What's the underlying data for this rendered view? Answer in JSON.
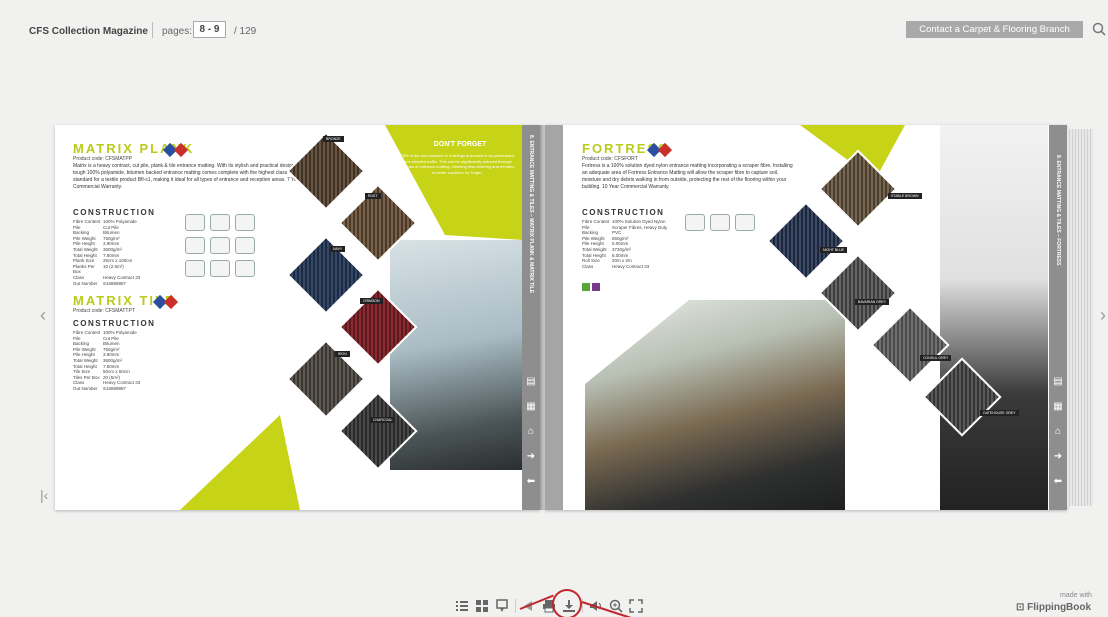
{
  "header": {
    "title": "CFS Collection Magazine",
    "pages_label": "pages:",
    "pages_value": "8 - 9",
    "pages_total": "/ 129",
    "contact_label": "Contact a Carpet & Flooring Branch"
  },
  "left_page": {
    "product1_title": "MATRIX PLANK",
    "product1_code": "Product code: CFSMATPP",
    "product1_desc": "Matrix is a heavy contract, cut pile, plank & tile entrance matting. With its stylish and practical design this tough 100% polyamide, bitumen backed entrance matting comes complete with the highest class of fire standard for a textile product Bfl-s1, making it ideal for all types of entrance and reception areas. 7 Year Commercial Warranty.",
    "construction_label": "CONSTRUCTION",
    "product1_specs": [
      [
        "Fibre Content",
        "100% Polyamide"
      ],
      [
        "Pile",
        "Cut Pile"
      ],
      [
        "Backing",
        "Bitumen"
      ],
      [
        "Pile Weight",
        "750g/m²"
      ],
      [
        "Pile Height",
        "3.90mm"
      ],
      [
        "Total Weight",
        "3600g/m²"
      ],
      [
        "Total Height",
        "7.60mm"
      ],
      [
        "Plank Size",
        "25cm x 100cm"
      ],
      [
        "Planks Per Box",
        "10 (2.5m²)"
      ],
      [
        "Class",
        "Heavy Contract 33"
      ],
      [
        "Gut Number",
        "S16889887"
      ]
    ],
    "product2_title": "MATRIX TILE",
    "product2_code": "Product code: CFSMATTPT",
    "product2_specs": [
      [
        "Fibre Content",
        "100% Polyamide"
      ],
      [
        "Pile",
        "Cut Pile"
      ],
      [
        "Backing",
        "Bitumen"
      ],
      [
        "Pile Weight",
        "750g/m²"
      ],
      [
        "Pile Height",
        "3.90mm"
      ],
      [
        "Total Weight",
        "3600g/m²"
      ],
      [
        "Total Height",
        "7.60mm"
      ],
      [
        "Tile Size",
        "50cm x 50cm"
      ],
      [
        "Tiles Per Box",
        "20 (5m²)"
      ],
      [
        "Class",
        "Heavy Contract 33"
      ],
      [
        "Gut Number",
        "S16889887"
      ]
    ],
    "dont_forget_title": "DON'T FORGET",
    "dont_forget_text": "75% of dirt and moisture in buildings is tracked in by pedestrians and wheeled traffic. This can be significantly reduced through the use of entrance matting, meaning less cleaning and remains is better condition for longer.",
    "strip_text": "8. ENTRANCE MATTING & TILES – MATRIX PLANK & MATRIX TILE",
    "swatch_labels": [
      "BRONZE",
      "RUST",
      "NAVY",
      "CRIMSON",
      "IRON",
      "CHARCOAL"
    ],
    "swatch_colors": [
      "#3d3226",
      "#4a3a2a",
      "#1d2a40",
      "#5a1a1e",
      "#3a3632",
      "#2a2a2a"
    ]
  },
  "right_page": {
    "product_title": "FORTRESS",
    "product_code": "Product code: CFSFORT",
    "product_desc": "Fortress is a 100% solution dyed nylon entrance matting incorporating a scraper fibre. Installing an adequate area of Fortress Entrance Matting will allow the scraper fibre to capture soil, moisture and dry debris walking in from outside, protecting the rest of the flooring within your building. 10 Year Commercial Warranty.",
    "construction_label": "CONSTRUCTION",
    "specs": [
      [
        "Fibre Content",
        "100% Solution Dyed Nylon"
      ],
      [
        "Pile",
        "Scraper Fibres, Heavy Duty"
      ],
      [
        "Backing",
        "PVC"
      ],
      [
        "Pile Weight",
        "860g/m²"
      ],
      [
        "Pile Height",
        "5.00mm"
      ],
      [
        "Total Weight",
        "3730g/m²"
      ],
      [
        "Total Height",
        "8.00mm"
      ],
      [
        "Roll Size",
        "20m x 2m"
      ],
      [
        "Class",
        "Heavy Contract 33"
      ]
    ],
    "strip_text": "8. ENTRANCE MATTING & TILES – FORTRESS",
    "swatch_labels": [
      "STABLE BROWN",
      "NIGHT BLUE",
      "BAVARIAN GREY",
      "CONSUL GREY",
      "GATEHOUSE GREY"
    ],
    "swatch_colors": [
      "#4a3f33",
      "#1e2738",
      "#3d3d3d",
      "#4a4a4a",
      "#353535"
    ]
  },
  "toolbar": {
    "icons": [
      "table-of-contents-icon",
      "thumbnails-icon",
      "bookmarks-icon",
      "share-icon",
      "print-icon",
      "download-icon",
      "sound-icon",
      "zoom-icon",
      "fullscreen-icon"
    ]
  },
  "branding": {
    "made_with": "made with",
    "brand": "FlippingBook"
  },
  "colors": {
    "accent_lime": "#c7d317",
    "annotation_red": "#c0282d",
    "contact_bg": "#a9a9a9"
  }
}
